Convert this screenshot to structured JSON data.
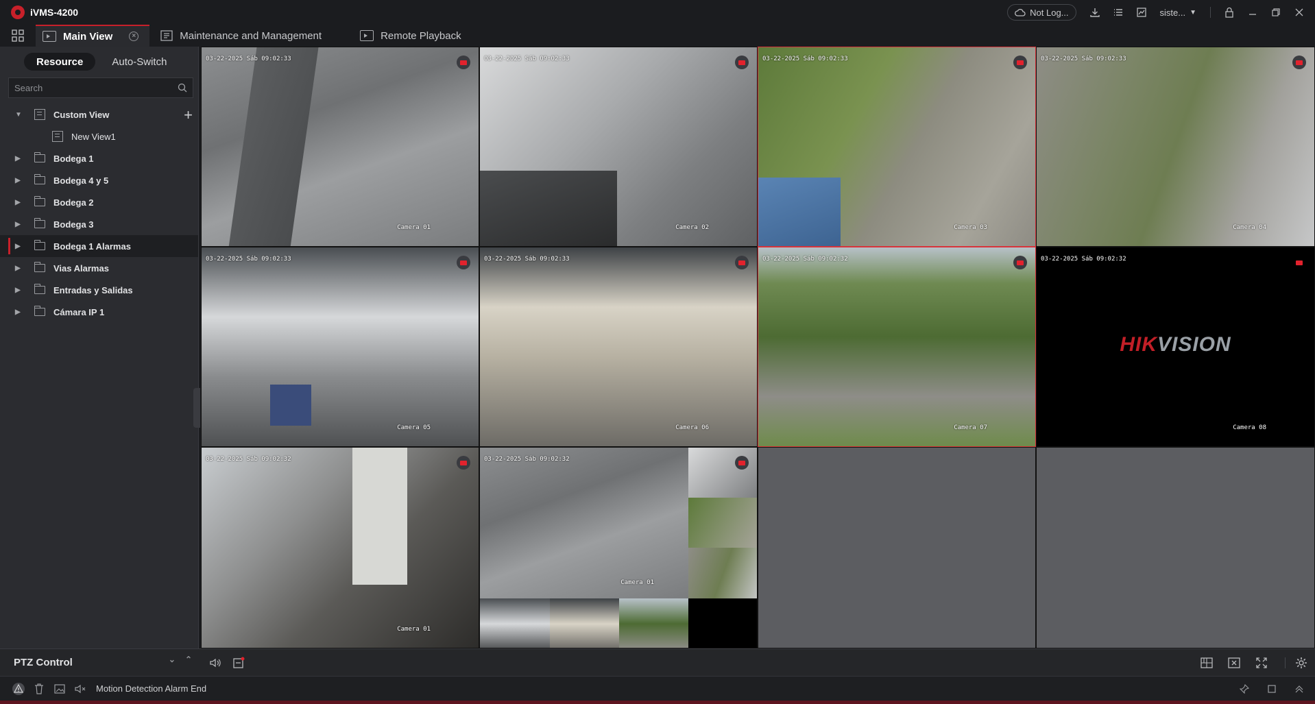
{
  "app": {
    "title": "iVMS-4200"
  },
  "titlebar": {
    "cloud_label": "Not Log...",
    "user_label": "siste..."
  },
  "tabs": [
    {
      "label": "Main View",
      "active": true
    },
    {
      "label": "Maintenance and Management",
      "active": false
    },
    {
      "label": "Remote Playback",
      "active": false
    }
  ],
  "sidebar": {
    "segments": [
      "Resource",
      "Auto-Switch"
    ],
    "search_placeholder": "Search",
    "tree": {
      "custom_view": "Custom View",
      "new_view": "New View1",
      "groups": [
        "Bodega 1",
        "Bodega 4 y 5",
        "Bodega 2",
        "Bodega 3",
        "Bodega 1 Alarmas",
        "Vias Alarmas",
        "Entradas y Salidas",
        "Cámara IP 1"
      ],
      "selected": "Bodega 1 Alarmas"
    }
  },
  "ptz": {
    "label": "PTZ Control"
  },
  "cameras": [
    {
      "time": "03-22-2025 Sáb 09:02:33",
      "name": "Camera 01"
    },
    {
      "time": "03-22-2025 Sáb 09:02:33",
      "name": "Camera 02"
    },
    {
      "time": "03-22-2025 Sáb 09:02:33",
      "name": "Camera 03"
    },
    {
      "time": "03-22-2025 Sáb 09:02:33",
      "name": "Camera 04"
    },
    {
      "time": "03-22-2025 Sáb 09:02:33",
      "name": "Camera 05"
    },
    {
      "time": "03-22-2025 Sáb 09:02:33",
      "name": "Camera 06"
    },
    {
      "time": "03-22-2025 Sáb 09:02:32",
      "name": "Camera 07"
    },
    {
      "time": "03-22-2025 Sáb 09:02:32",
      "name": "Camera 08"
    },
    {
      "time": "03-22-2025 Sáb 09:02:32",
      "name": "Camera 01"
    },
    {
      "time": "03-22-2025 Sáb 09:02:32",
      "name": "Camera 01"
    }
  ],
  "logo": {
    "hik": "HIK",
    "vision": "VISION"
  },
  "status": {
    "message": "Motion Detection Alarm End"
  },
  "colors": {
    "accent": "#c8202a",
    "rec": "#e2222d",
    "selected_border": "#d8333a"
  }
}
